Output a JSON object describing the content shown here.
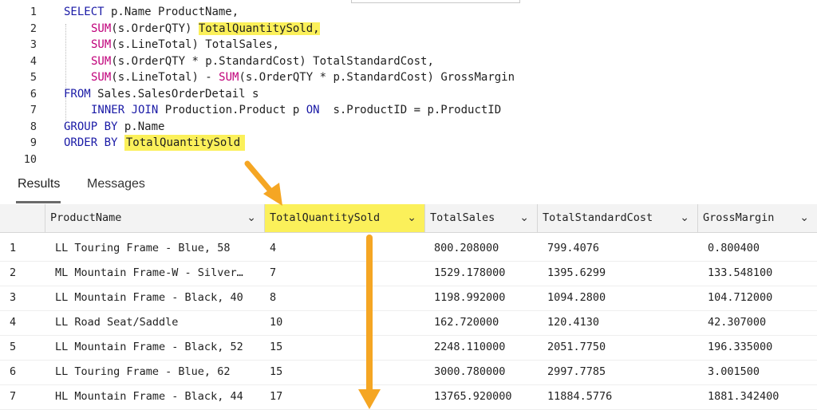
{
  "editor": {
    "lines": [
      {
        "num": "1"
      },
      {
        "num": "2"
      },
      {
        "num": "3"
      },
      {
        "num": "4"
      },
      {
        "num": "5"
      },
      {
        "num": "6"
      },
      {
        "num": "7"
      },
      {
        "num": "8"
      },
      {
        "num": "9"
      },
      {
        "num": "10"
      }
    ],
    "tokens": {
      "l1a": "SELECT",
      "l1b": " p.Name ProductName,",
      "l2a": "SUM",
      "l2b": "(s.OrderQTY) ",
      "l2c": "TotalQuantitySold,",
      "l3a": "SUM",
      "l3b": "(s.LineTotal) TotalSales,",
      "l4a": "SUM",
      "l4b": "(s.OrderQTY * p.StandardCost) TotalStandardCost,",
      "l5a": "SUM",
      "l5b": "(s.LineTotal) - ",
      "l5c": "SUM",
      "l5d": "(s.OrderQTY * p.StandardCost) GrossMargin",
      "l6a": "FROM",
      "l6b": " Sales.SalesOrderDetail s",
      "l7a": "INNER JOIN",
      "l7b": " Production.Product p ",
      "l7c": "ON",
      "l7d": "  s.ProductID = p.ProductID",
      "l8a": "GROUP BY",
      "l8b": " p.Name",
      "l9a": "ORDER BY",
      "l9b": " ",
      "l9c": "TotalQuantitySold"
    }
  },
  "tabs": {
    "results": "Results",
    "messages": "Messages"
  },
  "grid": {
    "columns": [
      "ProductName",
      "TotalQuantitySold",
      "TotalSales",
      "TotalStandardCost",
      "GrossMargin"
    ],
    "chevron": "⌄",
    "rows": [
      {
        "n": "1",
        "name": "LL Touring Frame - Blue, 58",
        "qty": "4",
        "sales": "800.208000",
        "cost": "799.4076",
        "margin": "0.800400"
      },
      {
        "n": "2",
        "name": "ML Mountain Frame-W - Silver…",
        "qty": "7",
        "sales": "1529.178000",
        "cost": "1395.6299",
        "margin": "133.548100"
      },
      {
        "n": "3",
        "name": "LL Mountain Frame - Black, 40",
        "qty": "8",
        "sales": "1198.992000",
        "cost": "1094.2800",
        "margin": "104.712000"
      },
      {
        "n": "4",
        "name": "LL Road Seat/Saddle",
        "qty": "10",
        "sales": "162.720000",
        "cost": "120.4130",
        "margin": "42.307000"
      },
      {
        "n": "5",
        "name": "LL Mountain Frame - Black, 52",
        "qty": "15",
        "sales": "2248.110000",
        "cost": "2051.7750",
        "margin": "196.335000"
      },
      {
        "n": "6",
        "name": "LL Touring Frame - Blue, 62",
        "qty": "15",
        "sales": "3000.780000",
        "cost": "2997.7785",
        "margin": "3.001500"
      },
      {
        "n": "7",
        "name": "HL Mountain Frame - Black, 44",
        "qty": "17",
        "sales": "13765.920000",
        "cost": "11884.5776",
        "margin": "1881.342400"
      }
    ]
  },
  "colors": {
    "highlight": "#fbf05a",
    "arrow": "#f5a623",
    "keyword": "#1a1aa6",
    "function": "#c0007a"
  }
}
